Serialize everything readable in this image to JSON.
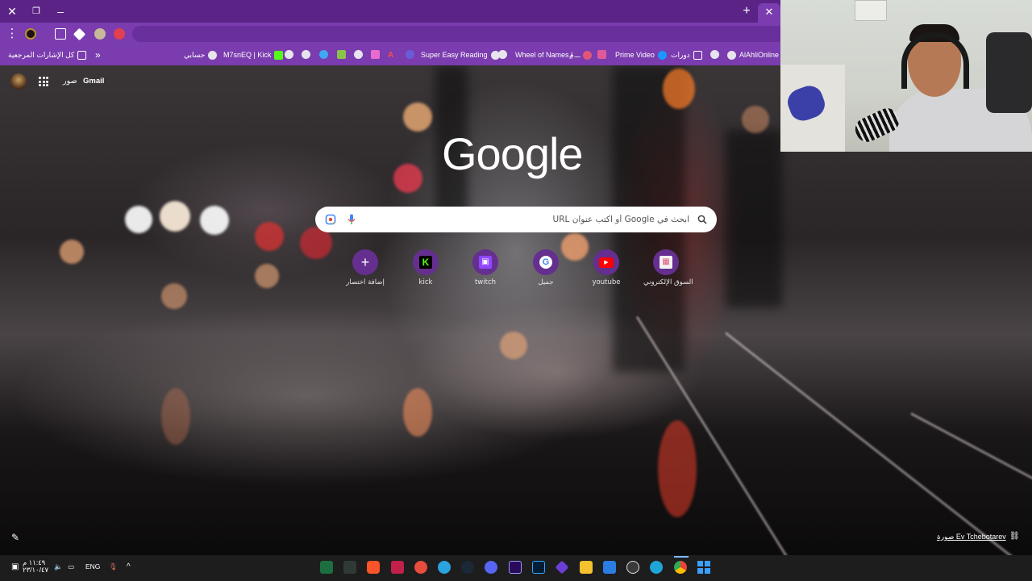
{
  "window": {
    "close_glyph": "✕",
    "restore_glyph": "❐",
    "minimize_glyph": "–",
    "new_tab_glyph": "+",
    "tab_close_glyph": "✕"
  },
  "toolbar": {
    "menu_glyph": "⋮",
    "extensions_glyph": "⧉"
  },
  "bookmarks": {
    "all_bookmarks": "كل الإشارات المرجعية",
    "overflow_glyph": "»",
    "items": [
      {
        "label": "حسابي"
      },
      {
        "label": "M7snEQ | Kick"
      },
      {
        "label": "Super Easy Reading"
      },
      {
        "label": "Wheel of Names | ..."
      },
      {
        "label": "م..."
      },
      {
        "label": "Prime Video"
      },
      {
        "label": "دورات"
      },
      {
        "label": "AlAhliOnline"
      }
    ]
  },
  "ntp": {
    "gmail": "Gmail",
    "images": "صور",
    "logo": "Google",
    "search_placeholder": "ابحث في Google أو اكتب عنوان URL",
    "shortcuts": [
      {
        "label": "إضافة اختصار",
        "icon": "plus-icon",
        "glyph": "+"
      },
      {
        "label": "kick",
        "icon": "kick-icon",
        "glyph": "K"
      },
      {
        "label": "twitch",
        "icon": "twitch-icon",
        "glyph": "▣"
      },
      {
        "label": "جميل",
        "icon": "google-icon",
        "glyph": "G"
      },
      {
        "label": "youtube",
        "icon": "youtube-icon",
        "glyph": "▶"
      },
      {
        "label": "السوق الإلكتروني",
        "icon": "store-icon",
        "glyph": "▦"
      }
    ],
    "customize_glyph": "✎",
    "photo_credit": "صورة Ev Tchebotarev",
    "link_glyph": "⛓"
  },
  "taskbar": {
    "time": "١١:٤٩ م",
    "date": "٢٣/١٠/٤٧",
    "language": "ENG",
    "chevron": "^"
  },
  "colors": {
    "chrome_frame": "#5b2386",
    "chrome_toolbar": "#7a3cae",
    "shortcut_bg": "#652f8f",
    "taskbar": "#1d1d1d"
  }
}
